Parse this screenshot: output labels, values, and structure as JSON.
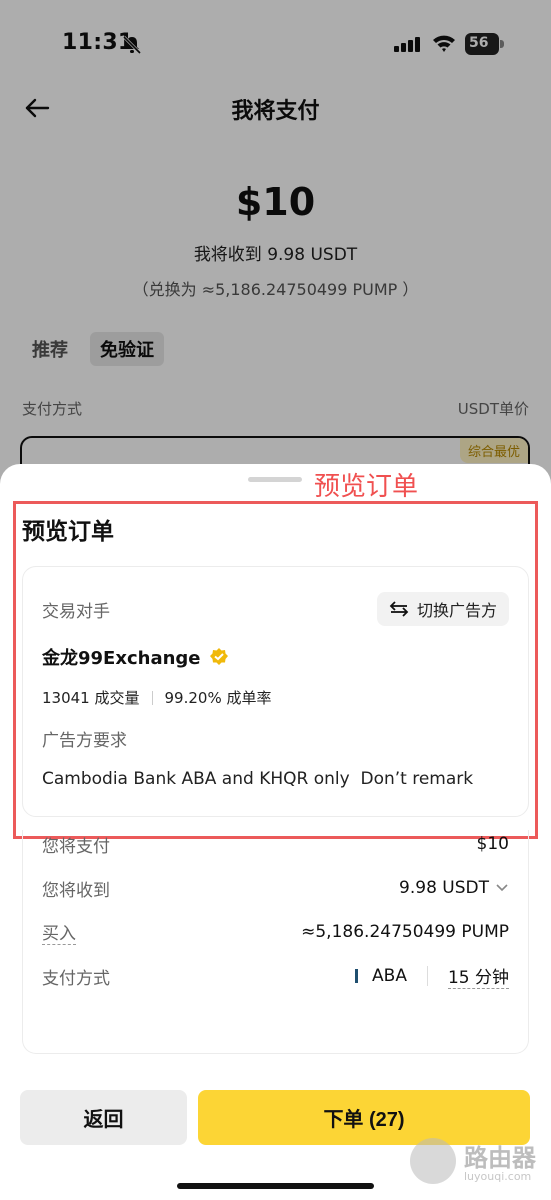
{
  "status_bar": {
    "time": "11:31",
    "battery": "56"
  },
  "nav": {
    "title": "我将支付"
  },
  "summary": {
    "amount": "$10",
    "receive": "我将收到 9.98 USDT",
    "convert": "（兑换为 ≈5,186.24750499 PUMP ）"
  },
  "filters": [
    "推荐",
    "免验证"
  ],
  "list_header": {
    "left": "支付方式",
    "right": "USDT单价"
  },
  "ad_badge": "综合最优",
  "annotation": "预览订单",
  "sheet": {
    "title": "预览订单",
    "counterparty_label": "交易对手",
    "switch_button": "切换广告方",
    "merchant": "金龙99Exchange",
    "trades": "13041 成交量",
    "completion": "99.20% 成单率",
    "req_label": "广告方要求",
    "req_text": "Cambodia Bank ABA and KHQR only  Don’t remark"
  },
  "summary_rows": {
    "pay_label": "您将支付",
    "pay_value": "$10",
    "receive_label": "您将收到",
    "receive_value": "9.98 USDT",
    "buy_label": "买入",
    "buy_value": "≈5,186.24750499 PUMP",
    "method_label": "支付方式",
    "method_value": "ABA",
    "time_limit": "15 分钟"
  },
  "buttons": {
    "back": "返回",
    "order": "下单 (27)"
  },
  "watermark": {
    "text": "路由器",
    "sub": "luyouqi.com"
  },
  "colors": {
    "accent": "#fcd535",
    "annotation": "#ec5a5a"
  }
}
